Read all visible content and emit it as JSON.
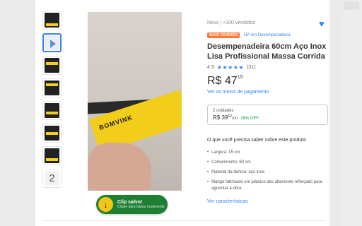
{
  "product": {
    "condition_sold": "Novo  |  +100 vendidos",
    "badge": "MAIS VENDIDO",
    "rank": "15º em Desempenadeira",
    "title": "Desempenadeira 60cm Aço Inox Lisa Profissional Massa Corrida",
    "rating_value": "4.9",
    "rating_stars": 5,
    "review_count": "(31)",
    "price_currency": "R$",
    "price_int": "47",
    "price_cents": "15",
    "payment_link": "Ver os meios de pagamento"
  },
  "bundle": {
    "units": "2 unidades",
    "price_currency": "R$",
    "price_int": "39",
    "price_cents": "62",
    "per_unit": "/un.",
    "discount": "16% OFF"
  },
  "details": {
    "section_title": "O que você precisa saber sobre este produto",
    "features": [
      "Largura: 15 cm",
      "Comprimento: 60 cm",
      "Material da lâmina: aço inox.",
      "Mango fabricado em plástico abs altamente reforçado para aguentar a obra."
    ],
    "characteristics_link": "Ver características"
  },
  "gallery": {
    "brand_text": "BOMVINK",
    "more_count": "2"
  },
  "toast": {
    "title": "Clip salvo!",
    "subtitle": "Clique para baixar novamente",
    "icon": "download-arrow-icon"
  },
  "colors": {
    "accent": "#3483fa",
    "badge": "#ff7733",
    "discount": "#00a650",
    "toast_bg": "#1e7e34",
    "toast_icon": "#f5c518"
  }
}
